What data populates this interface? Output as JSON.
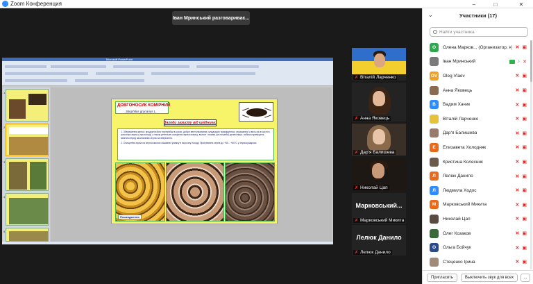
{
  "window": {
    "title": "Zoom Конференция",
    "icon": "zoom-logo-icon",
    "controls": [
      "minimize-icon",
      "maximize-icon",
      "close-icon"
    ]
  },
  "speaking_indicator": "Іван Мринський разговариває...",
  "shared_screen": {
    "app": "Microsoft PowerPoint",
    "thumbnail_numbers": [
      "1",
      "2",
      "3",
      "4",
      "5"
    ],
    "slide": {
      "title": "ДОВГОНОСИК КОМІРНИЙ",
      "subtitle": "Sitophilus granarius L.",
      "heading": "Заходи захисту від шкідника:",
      "items": [
        "1. Збереження зерна і продуктів його переробки в сухих, добре вентильованих складських приміщеннях, утримання їх весь рік в чистоті, розсилка зерна у прохолоді, а також ретельне очищення зерносховищ, вологе і газова (за потреби) дезінсекція, побілка приміщень вапном перед засипанням зерна на зберігання.",
        "2. Очищення зерна на зерноочисних машинах узимку в морозну погоду. Прогрівання зерна до +50…+60°С у зерносушарках."
      ],
      "photo_label": "Пошкодження"
    }
  },
  "video_tiles": [
    {
      "name": "Віталій Ларченко",
      "muted": true,
      "type": "flag"
    },
    {
      "name": "Анна Яковець",
      "muted": true,
      "type": "video"
    },
    {
      "name": "Дар'я Балишева",
      "muted": true,
      "type": "video"
    },
    {
      "name": "Николай Цап",
      "muted": true,
      "type": "video"
    },
    {
      "name": "Марковський Микита",
      "big_name": "Марковський...",
      "muted": true,
      "type": "name"
    },
    {
      "name": "Лелюк Данило",
      "big_name": "Лелюк Данило",
      "muted": true,
      "type": "name"
    }
  ],
  "panel": {
    "title": "Участники (17)",
    "search_placeholder": "Найти участника",
    "participants": [
      {
        "initials": "О",
        "color": "#2fa84f",
        "name": "Олена Марков... (Организатор, я)",
        "mic": "off",
        "cam": "off"
      },
      {
        "initials": "",
        "color": "#7a7a7a",
        "name": "Іван Мринський",
        "mic": "on",
        "cam": "on"
      },
      {
        "initials": "OV",
        "color": "#f0a020",
        "name": "Oleg Vlaev",
        "mic": "off",
        "cam": "off"
      },
      {
        "initials": "",
        "color": "#8a6a50",
        "name": "Анна Яковець",
        "mic": "off",
        "cam": "off"
      },
      {
        "initials": "В",
        "color": "#2d8cff",
        "name": "Вадим Хачик",
        "mic": "off",
        "cam": "off"
      },
      {
        "initials": "",
        "color": "#e6c23a",
        "name": "Віталій Ларченко",
        "mic": "off",
        "cam": "off"
      },
      {
        "initials": "",
        "color": "#9a7a6a",
        "name": "Дар'я Балишева",
        "mic": "off",
        "cam": "off"
      },
      {
        "initials": "Е",
        "color": "#e86a1a",
        "name": "Елизавета Холодняк",
        "mic": "off",
        "cam": "off"
      },
      {
        "initials": "",
        "color": "#6a5a4a",
        "name": "Кристина Колесник",
        "mic": "off",
        "cam": "off"
      },
      {
        "initials": "Л",
        "color": "#e86a1a",
        "name": "Лелюк Данило",
        "mic": "off",
        "cam": "off"
      },
      {
        "initials": "Л",
        "color": "#2d8cff",
        "name": "Людмила Ходос",
        "mic": "off",
        "cam": "off"
      },
      {
        "initials": "М",
        "color": "#e86a1a",
        "name": "Марковський Микита",
        "mic": "off",
        "cam": "off"
      },
      {
        "initials": "",
        "color": "#5a4a40",
        "name": "Николай Цап",
        "mic": "off",
        "cam": "off"
      },
      {
        "initials": "",
        "color": "#3a6a3a",
        "name": "Олег Козаков",
        "mic": "off",
        "cam": "off"
      },
      {
        "initials": "О",
        "color": "#2a4a8a",
        "name": "Ольга Бойчук",
        "mic": "off",
        "cam": "off"
      },
      {
        "initials": "",
        "color": "#a08a7a",
        "name": "Стеценко Ірина",
        "mic": "off",
        "cam": "off"
      }
    ],
    "invite_label": "Пригласить",
    "mute_all_label": "Выключить звук для всех",
    "more_label": "..."
  }
}
